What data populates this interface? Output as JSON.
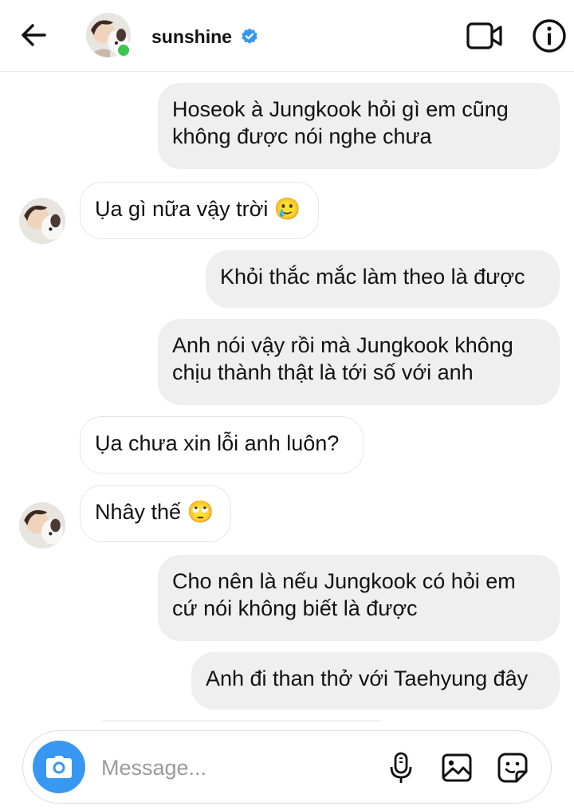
{
  "header": {
    "username": "sunshine",
    "verified": true,
    "online": true,
    "accent_color": "#3897f0",
    "online_color": "#3ec74f",
    "icons": [
      "back-arrow-icon",
      "video-call-icon",
      "info-icon",
      "verified-badge-icon"
    ]
  },
  "messages": [
    {
      "side": "sent",
      "text": "Hoseok à Jungkook hỏi gì em cũng không được nói nghe chưa"
    },
    {
      "side": "received",
      "text": "Ụa gì nữa vậy trời 🥲",
      "avatar": true
    },
    {
      "side": "sent",
      "text": "Khỏi thắc mắc làm theo là được"
    },
    {
      "side": "sent",
      "text": "Anh nói vậy rồi mà Jungkook không chịu thành thật là tới số với anh"
    },
    {
      "side": "received",
      "text": "Ụa chưa xin lỗi anh luôn?",
      "avatar": false
    },
    {
      "side": "received",
      "text": "Nhây thế 🙄",
      "avatar": true
    },
    {
      "side": "sent",
      "text": "Cho nên là nếu Jungkook có hỏi em cứ nói không biết là được"
    },
    {
      "side": "sent",
      "text": "Anh đi than thở với Taehyung đây"
    }
  ],
  "composer": {
    "placeholder": "Message...",
    "value": "",
    "icons": [
      "camera-icon",
      "microphone-icon",
      "gallery-icon",
      "sticker-icon"
    ]
  }
}
